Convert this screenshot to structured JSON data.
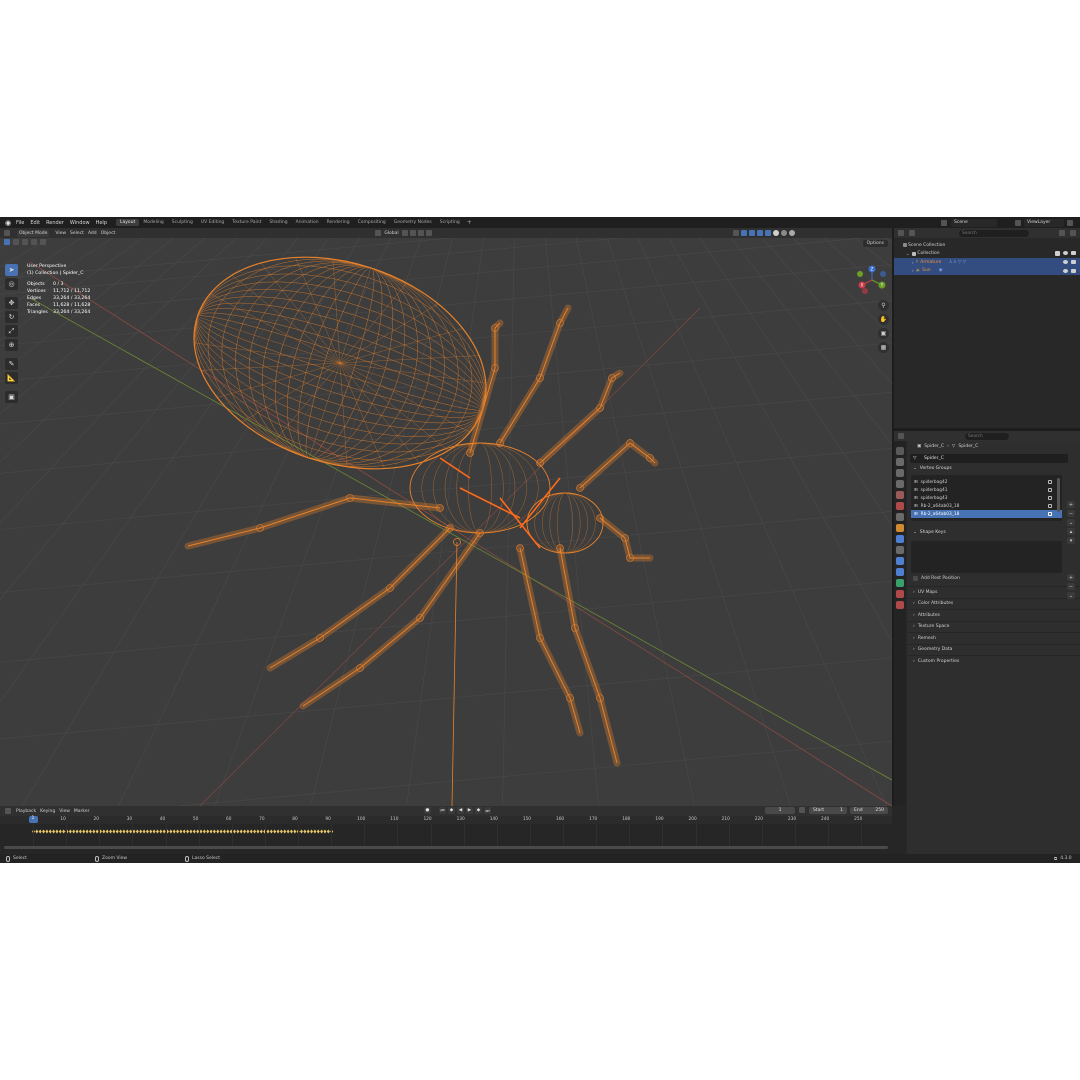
{
  "topbar": {
    "menus": [
      "File",
      "Edit",
      "Render",
      "Window",
      "Help"
    ],
    "workspaces": [
      "Layout",
      "Modeling",
      "Sculpting",
      "UV Editing",
      "Texture Paint",
      "Shading",
      "Animation",
      "Rendering",
      "Compositing",
      "Geometry Nodes",
      "Scripting"
    ],
    "active_workspace": "Layout",
    "add_label": "+",
    "scene": "Scene",
    "view_layer": "ViewLayer"
  },
  "viewport": {
    "mode": "Object Mode",
    "menus": [
      "View",
      "Select",
      "Add",
      "Object"
    ],
    "transform_orientation": "Global",
    "options_label": "Options",
    "perspective": "User Perspective",
    "collection_line": "(1) Collection | Spider_C",
    "stats": [
      {
        "label": "Objects",
        "value": "0 / 3"
      },
      {
        "label": "Vertices",
        "value": "11,712 / 11,712"
      },
      {
        "label": "Edges",
        "value": "33,264 / 33,264"
      },
      {
        "label": "Faces",
        "value": "11,628 / 11,628"
      },
      {
        "label": "Triangles",
        "value": "33,264 / 33,264"
      }
    ],
    "gizmo_axes": [
      "X",
      "Y",
      "Z"
    ],
    "wire_color": "#e8822a",
    "bg_color": "#3d3d3d"
  },
  "outliner": {
    "search_placeholder": "Search",
    "items": [
      {
        "label": "Scene Collection",
        "selected": false
      },
      {
        "label": "Collection",
        "selected": false
      },
      {
        "label": "Armature",
        "selected": true
      },
      {
        "label": "Sun",
        "selected": true
      }
    ]
  },
  "properties": {
    "search_placeholder": "Search",
    "breadcrumb": [
      "Spider_C",
      "Spider_C"
    ],
    "mesh_name": "Spider_C",
    "vertex_groups_title": "Vertex Groups",
    "vertex_groups": [
      {
        "name": "spiderbag42",
        "selected": false
      },
      {
        "name": "spiderbag41",
        "selected": false
      },
      {
        "name": "spiderbag43",
        "selected": false
      },
      {
        "name": "Rb-2_a64ab03_18",
        "selected": false
      },
      {
        "name": "Rb-2_a64ab03_18",
        "selected": true
      }
    ],
    "shape_keys_title": "Shape Keys",
    "add_rest_position": "Add Rest Position",
    "panels": [
      "UV Maps",
      "Color Attributes",
      "Attributes",
      "Texture Space",
      "Remesh",
      "Geometry Data",
      "Custom Properties"
    ]
  },
  "timeline": {
    "menus": [
      "Playback",
      "Keying",
      "View",
      "Marker"
    ],
    "current_frame": "1",
    "start_label": "Start",
    "start": "1",
    "end_label": "End",
    "end": "250",
    "ruler": [
      "1",
      "10",
      "20",
      "30",
      "40",
      "50",
      "60",
      "70",
      "80",
      "90",
      "100",
      "110",
      "120",
      "130",
      "140",
      "150",
      "160",
      "170",
      "180",
      "190",
      "200",
      "210",
      "220",
      "230",
      "240",
      "250"
    ]
  },
  "statusbar": {
    "select": "Select",
    "zoom_view": "Zoom View",
    "lasso_select": "Lasso Select",
    "version": "4.3.0"
  }
}
